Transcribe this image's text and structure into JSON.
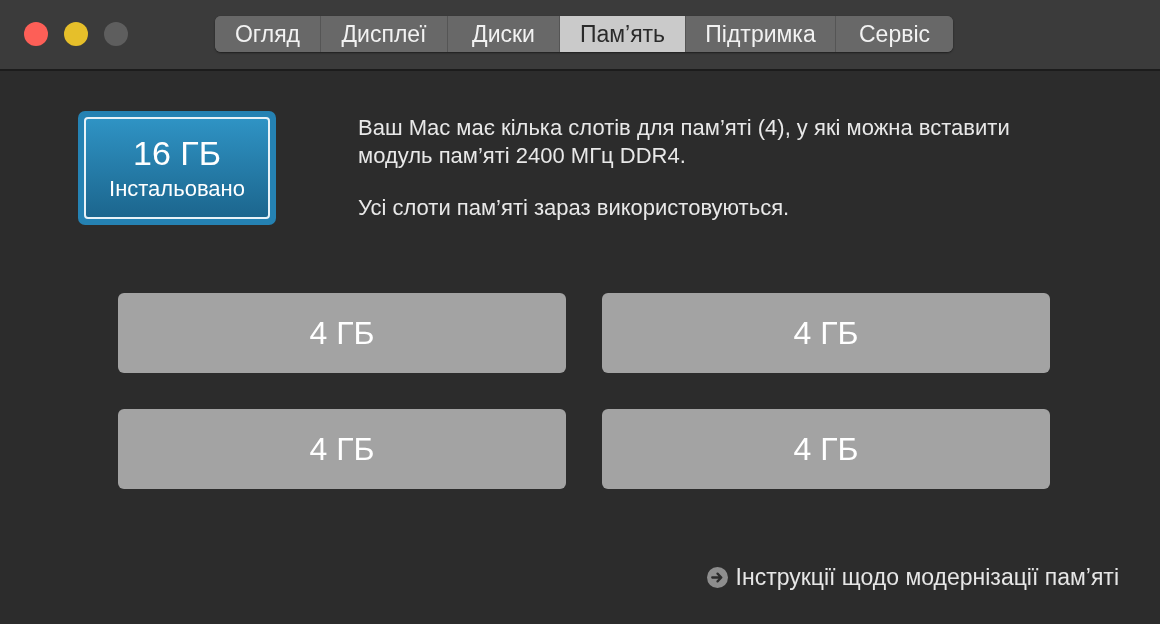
{
  "window": {
    "controls": [
      {
        "disabled": false
      },
      {
        "disabled": false
      },
      {
        "disabled": true
      }
    ]
  },
  "tabs": [
    {
      "label": "Огляд",
      "selected": false
    },
    {
      "label": "Дисплеї",
      "selected": false
    },
    {
      "label": "Диски",
      "selected": false
    },
    {
      "label": "Пам’ять",
      "selected": true
    },
    {
      "label": "Підтримка",
      "selected": false
    },
    {
      "label": "Сервіс",
      "selected": false
    }
  ],
  "installed": {
    "amount": "16 ГБ",
    "label": "Інстальовано"
  },
  "description": [
    "Ваш Mac має кілька слотів для пам’яті (4), у які можна вставити модуль пам’яті 2400 МГц DDR4.",
    "Усі слоти пам’яті зараз використовуються."
  ],
  "slots": [
    {
      "label": "4 ГБ"
    },
    {
      "label": "4 ГБ"
    },
    {
      "label": "4 ГБ"
    },
    {
      "label": "4 ГБ"
    }
  ],
  "link": {
    "label": "Інструкції щодо модернізації пам’яті"
  }
}
